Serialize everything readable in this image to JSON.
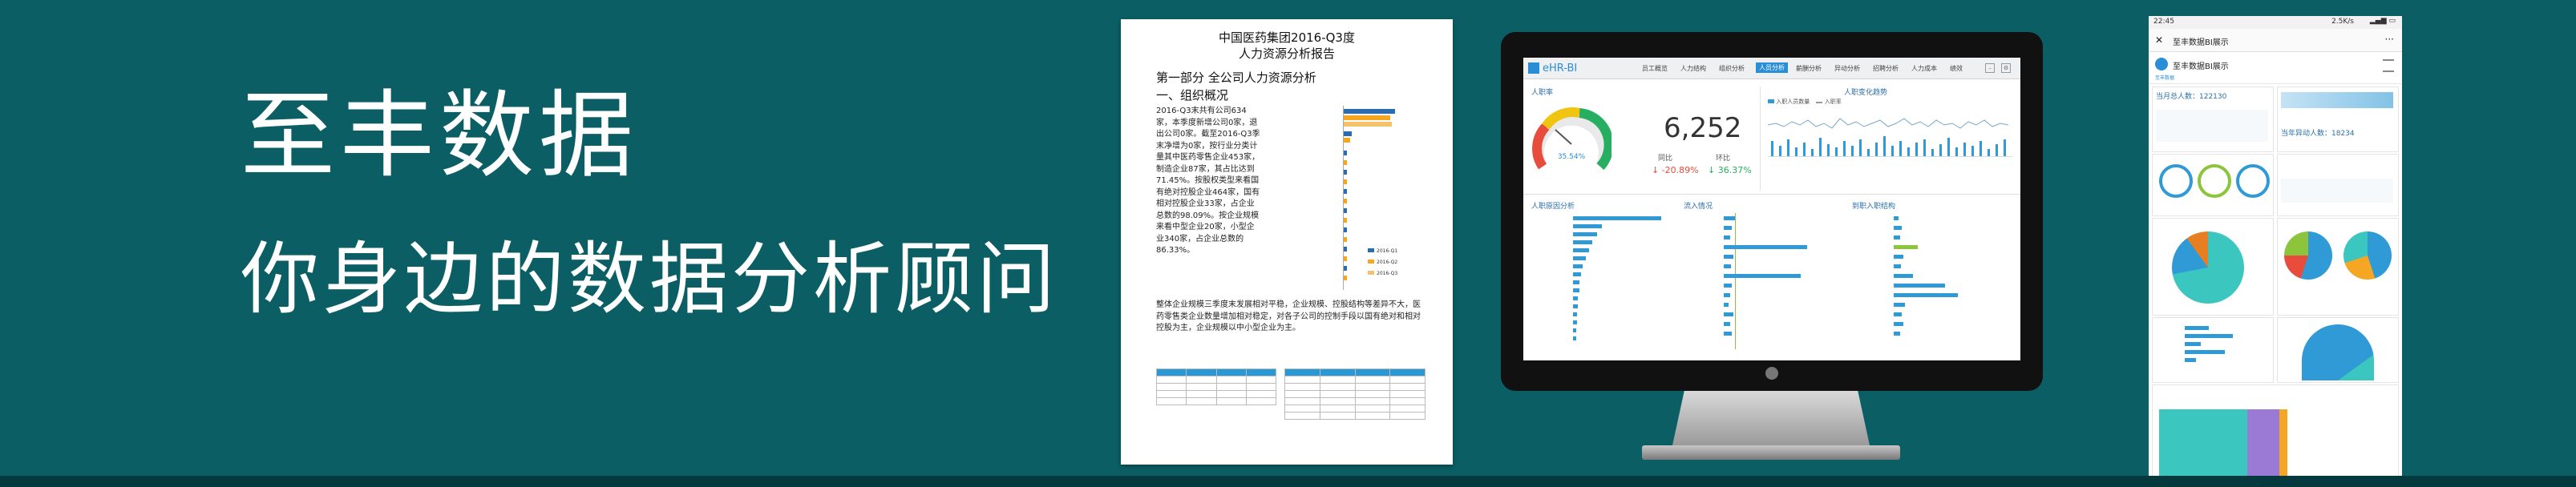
{
  "headline": {
    "title": "至丰数据",
    "subtitle": "你身边的数据分析顾问"
  },
  "colors": {
    "background": "#0b5f64",
    "accent": "#2a8ed6",
    "orange": "#f5a623",
    "green": "#8cc43c"
  },
  "report": {
    "title_line1": "中国医药集团2016-Q3度",
    "title_line2": "人力资源分析报告",
    "section": "第一部分  全公司人力资源分析",
    "subsection": "一、组织概况",
    "body": "2016-Q3末共有公司634家，本季度新增公司0家，退出公司0家。截至2016-Q3季末净增为0家，按行业分类计量其中医药零售企业453家，制造企业87家，其占比达到71.45%。按股权类型来看国有绝对控股企业464家，国有相对控股企业33家，占企业总数的98.09%。按企业规模来看中型企业20家，小型企业340家，占企业总数的86.33%。",
    "paragraph": "整体企业规模三季度末发展相对平稳，企业规模、控股结构等差异不大，医药零售类企业数量增加相对稳定，对各子公司的控制手段以国有绝对和相对控股为主，企业规模以中小型企业为主。",
    "legend": [
      "2016-Q1",
      "2016-Q2",
      "2016-Q3"
    ]
  },
  "dashboard": {
    "app_name": "eHR-BI",
    "nav": [
      "员工概览",
      "人力结构",
      "组织分析",
      "人员分析",
      "薪酬分析",
      "异动分析",
      "招聘分析",
      "人力成本",
      "绩效"
    ],
    "active_nav_index": 3,
    "headcount_panel": "人职率",
    "gauge_percent": "35.54%",
    "kpi_value": "6,252",
    "yoy_label": "同比",
    "mom_label": "环比",
    "yoy_value": "↓ -20.89%",
    "mom_value": "↓ 36.37%",
    "trend_title": "人职变化趋势",
    "trend_legend": [
      "入职人员数量",
      "入职率"
    ],
    "panel_left": "人职原因分析",
    "panel_mid": "流入情况",
    "panel_right": "到职入职结构"
  },
  "phone": {
    "time": "22:45",
    "status_right": "2.5K/s",
    "nav_title": "至丰数据BI展示",
    "app_title": "至丰数据BI展示",
    "brand": "至丰数据",
    "total_label": "当月总人数：122130",
    "transfer_label": "当年异动人数：18234"
  }
}
